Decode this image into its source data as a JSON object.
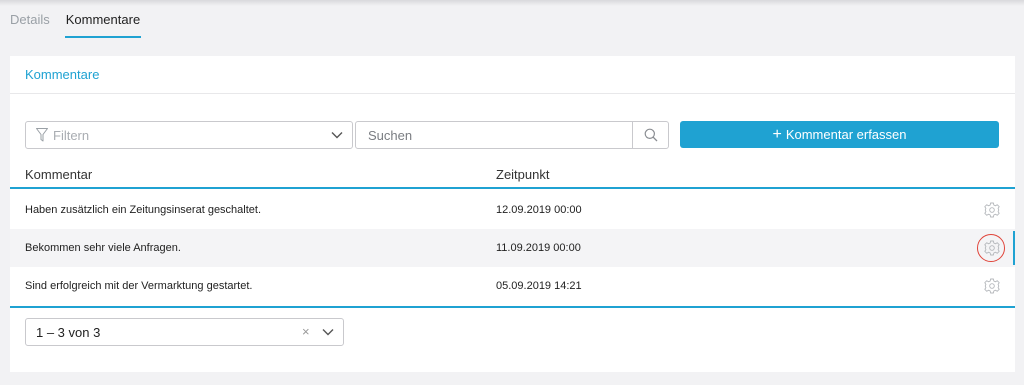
{
  "tabs": [
    {
      "label": "Details",
      "active": false
    },
    {
      "label": "Kommentare",
      "active": true
    }
  ],
  "card": {
    "title": "Kommentare"
  },
  "toolbar": {
    "filter_placeholder": "Filtern",
    "search_placeholder": "Suchen",
    "add_label": "Kommentar erfassen"
  },
  "table": {
    "columns": [
      "Kommentar",
      "Zeitpunkt"
    ],
    "rows": [
      {
        "comment": "Haben zusätzlich ein Zeitungsinserat geschaltet.",
        "time": "12.09.2019 00:00"
      },
      {
        "comment": "Bekommen sehr viele Anfragen.",
        "time": "11.09.2019 00:00"
      },
      {
        "comment": "Sind erfolgreich mit der Vermarktung gestartet.",
        "time": "05.09.2019 14:21"
      }
    ]
  },
  "pager": {
    "value": "1 – 3 von 3",
    "clear": "×"
  },
  "colors": {
    "accent": "#1fa2d2",
    "highlight": "#e0443a"
  },
  "icons": {
    "filter": "funnel-icon",
    "dropdown": "chevron-down-icon",
    "search": "search-icon",
    "add": "plus-icon",
    "row_action": "gear-icon"
  }
}
